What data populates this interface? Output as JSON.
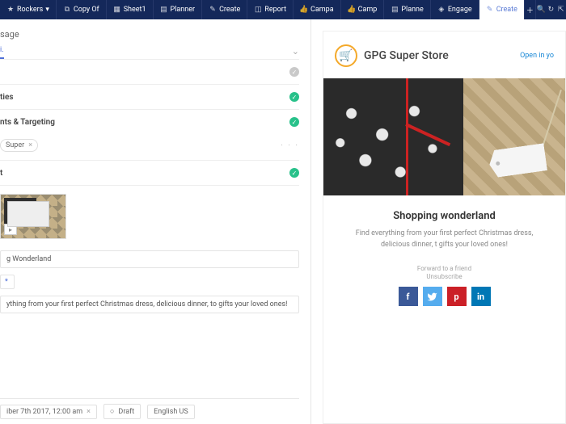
{
  "topbar": {
    "tabs": [
      {
        "icon": "star",
        "label": "Rockers"
      },
      {
        "icon": "copy",
        "label": "Copy Of"
      },
      {
        "icon": "sheet",
        "label": "Sheet1"
      },
      {
        "icon": "planner",
        "label": "Planner"
      },
      {
        "icon": "create",
        "label": "Create"
      },
      {
        "icon": "report",
        "label": "Report"
      },
      {
        "icon": "campaign",
        "label": "Campa"
      },
      {
        "icon": "campaign",
        "label": "Camp"
      },
      {
        "icon": "planner",
        "label": "Planne"
      },
      {
        "icon": "engage",
        "label": "Engage"
      },
      {
        "icon": "create",
        "label": "Create"
      }
    ],
    "active": 10
  },
  "leftTitle": "sage",
  "miniTabs": {
    "active": "i.",
    "items": [
      "i."
    ]
  },
  "sections": [
    {
      "label": "",
      "status": "gray"
    },
    {
      "label": "ties",
      "status": "ok"
    },
    {
      "label": "nts & Targeting",
      "status": "ok"
    },
    {
      "label": "t",
      "status": "ok"
    }
  ],
  "chip": {
    "text": "Super",
    "close": "×"
  },
  "fields": {
    "subject": "g Wonderland",
    "emoji": "*",
    "body": "ything from your first perfect Christmas dress, delicious dinner, to gifts your loved ones!"
  },
  "footer": {
    "schedule": "iber 7th 2017, 12:00 am",
    "status": "Draft",
    "locale": "English US"
  },
  "email": {
    "brand": "GPG Super Store",
    "openLink": "Open in yo",
    "title": "Shopping wonderland",
    "desc": "Find everything from your first perfect Christmas dress, delicious dinner, t gifts your loved ones!",
    "forward": "Forward to a friend",
    "unsub": "Unsubscribe",
    "logoIcon": "🛒"
  }
}
